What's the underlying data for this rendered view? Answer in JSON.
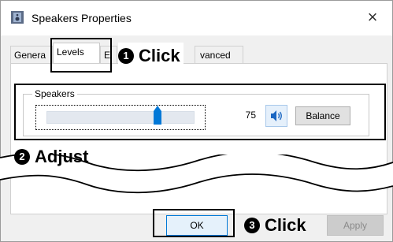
{
  "window": {
    "title": "Speakers Properties",
    "close_label": "×"
  },
  "tabs": [
    {
      "label": "Genera"
    },
    {
      "label": "Levels",
      "active": true
    },
    {
      "label": "E"
    },
    {
      "label": "vanced"
    }
  ],
  "levels": {
    "group_label": "Speakers",
    "volume_value": "75",
    "volume_level": 75,
    "balance_label": "Balance"
  },
  "buttons": {
    "ok_label": "OK",
    "apply_label": "Apply"
  },
  "annotations": [
    {
      "number": "1",
      "text": "Click"
    },
    {
      "number": "2",
      "text": "Adjust"
    },
    {
      "number": "3",
      "text": "Click"
    }
  ],
  "colors": {
    "accent": "#0078d7",
    "slider_track": "#e3e8ef"
  }
}
